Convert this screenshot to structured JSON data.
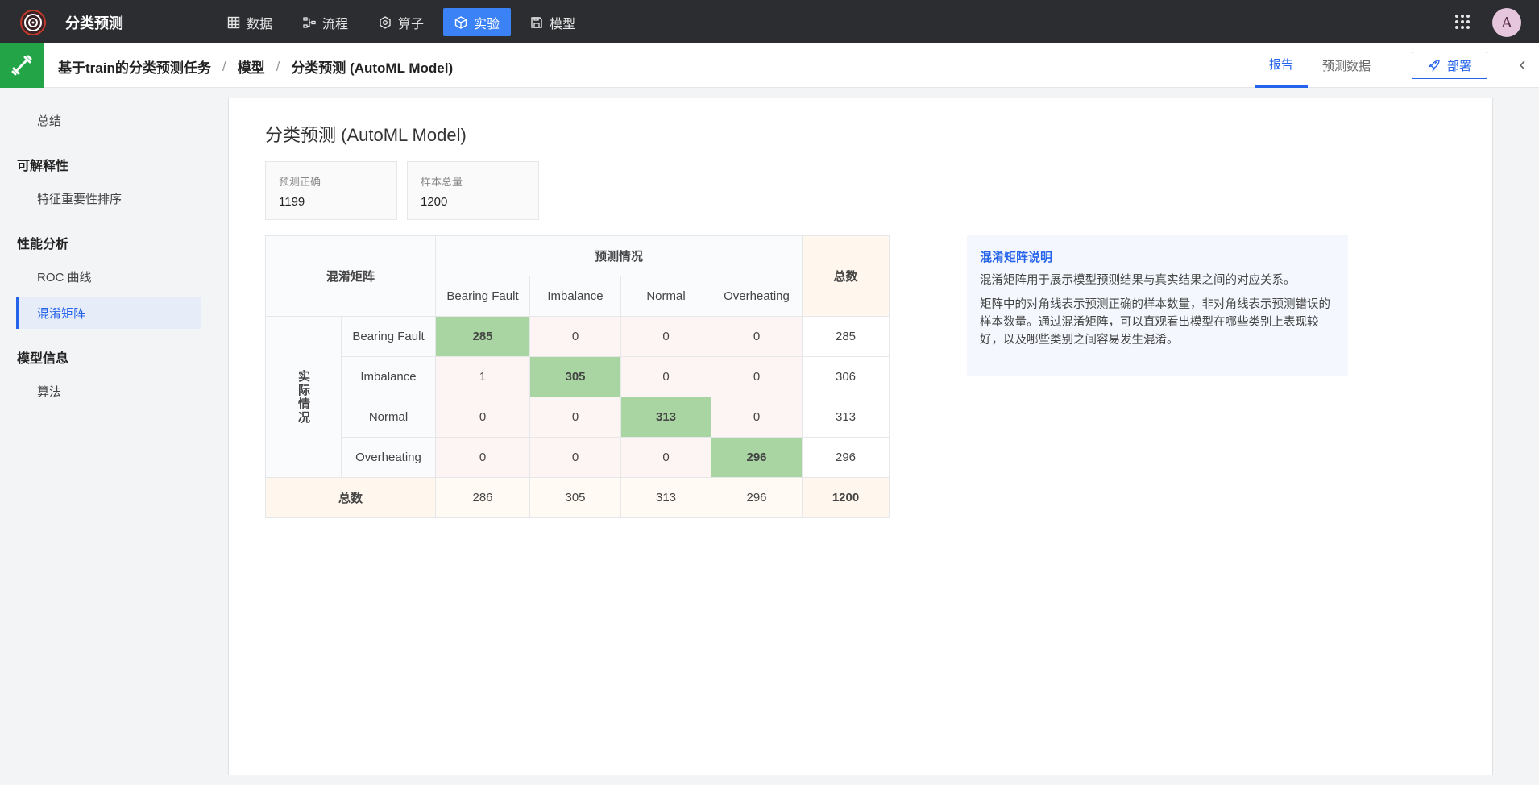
{
  "topbar": {
    "title": "分类预测",
    "nav": [
      {
        "label": "数据",
        "icon": "table-icon"
      },
      {
        "label": "流程",
        "icon": "flow-icon"
      },
      {
        "label": "算子",
        "icon": "operator-icon"
      },
      {
        "label": "实验",
        "icon": "cube-icon"
      },
      {
        "label": "模型",
        "icon": "save-icon"
      }
    ],
    "active_nav": "实验",
    "avatar": "A"
  },
  "breadcrumb": [
    "基于train的分类预测任务",
    "模型",
    "分类预测 (AutoML Model)"
  ],
  "tabs": [
    {
      "label": "报告"
    },
    {
      "label": "预测数据"
    }
  ],
  "deploy_label": "部署",
  "sidebar": {
    "summary": "总结",
    "groups": [
      {
        "title": "可解释性",
        "items": [
          "特征重要性排序"
        ]
      },
      {
        "title": "性能分析",
        "items": [
          "ROC 曲线",
          "混淆矩阵"
        ]
      },
      {
        "title": "模型信息",
        "items": [
          "算法"
        ]
      }
    ],
    "active": "混淆矩阵"
  },
  "main": {
    "title": "分类预测 (AutoML Model)",
    "stats": [
      {
        "label": "预测正确",
        "value": "1199"
      },
      {
        "label": "样本总量",
        "value": "1200"
      }
    ]
  },
  "matrix": {
    "corner": "混淆矩阵",
    "predicted_label": "预测情况",
    "actual_label": "实际情况",
    "total_label": "总数",
    "classes": [
      "Bearing Fault",
      "Imbalance",
      "Normal",
      "Overheating"
    ],
    "rows": [
      [
        285,
        0,
        0,
        0
      ],
      [
        1,
        305,
        0,
        0
      ],
      [
        0,
        0,
        313,
        0
      ],
      [
        0,
        0,
        0,
        296
      ]
    ],
    "row_totals": [
      285,
      306,
      313,
      296
    ],
    "col_totals": [
      286,
      305,
      313,
      296
    ],
    "grand_total": 1200
  },
  "info": {
    "title": "混淆矩阵说明",
    "p1": "混淆矩阵用于展示模型预测结果与真实结果之间的对应关系。",
    "p2": "矩阵中的对角线表示预测正确的样本数量，非对角线表示预测错误的样本数量。通过混淆矩阵，可以直观看出模型在哪些类别上表现较好，以及哪些类别之间容易发生混淆。"
  }
}
